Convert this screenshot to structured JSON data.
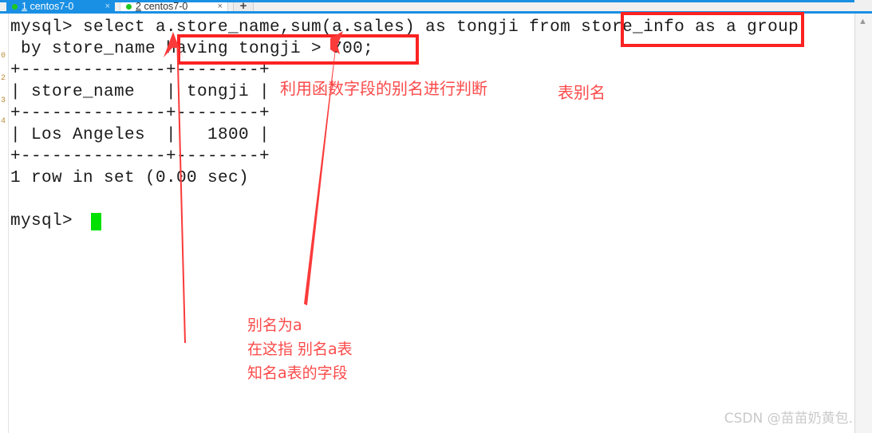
{
  "window": {
    "tabs": [
      {
        "number": "1",
        "label": "centos7-0",
        "active": true,
        "status_icon": "green-dot",
        "close_icon": "×"
      },
      {
        "number": "2",
        "label": "centos7-0",
        "active": false,
        "status_icon": "green-dot",
        "close_icon": "×"
      }
    ],
    "new_tab_label": "+",
    "scroll_up_icon": "▲",
    "active_tab_color": "#1a90e4",
    "tab_dot_color": "#1ec81e"
  },
  "terminal": {
    "lines": [
      "mysql> select a.store_name,sum(a.sales) as tongji from store_info as a group",
      " by store_name having tongji > 700;",
      "+--------------+--------+",
      "| store_name   | tongji |",
      "+--------------+--------+",
      "| Los Angeles  |   1800 |",
      "+--------------+--------+",
      "1 row in set (0.00 sec)",
      "",
      "mysql> "
    ],
    "query_result": {
      "columns": [
        "store_name",
        "tongji"
      ],
      "rows": [
        [
          "Los Angeles",
          "1800"
        ]
      ],
      "status": "1 row in set (0.00 sec)"
    },
    "prompt": "mysql>",
    "cursor": "block",
    "cursor_color": "#00e000",
    "text_color": "#1b1b1b",
    "background": "#ffffff"
  },
  "annotations": {
    "highlight_color": "#fb2222",
    "text_color": "#fb4a4a",
    "boxes": [
      {
        "name": "having-clause-box",
        "target": "having tongji > 700;"
      },
      {
        "name": "table-alias-box",
        "target": "store_info as a"
      }
    ],
    "labels": [
      {
        "name": "alias-judgement-note",
        "text": "利用函数字段的别名进行判断"
      },
      {
        "name": "table-alias-note",
        "text": "表别名"
      },
      {
        "name": "alias-note-line1",
        "text": "别名为a"
      },
      {
        "name": "alias-note-line2",
        "text": "在这指 别名a表"
      },
      {
        "name": "alias-note-line3",
        "text": "知名a表的字段"
      }
    ]
  },
  "watermark": {
    "text": "CSDN @苗苗奶黄包."
  }
}
